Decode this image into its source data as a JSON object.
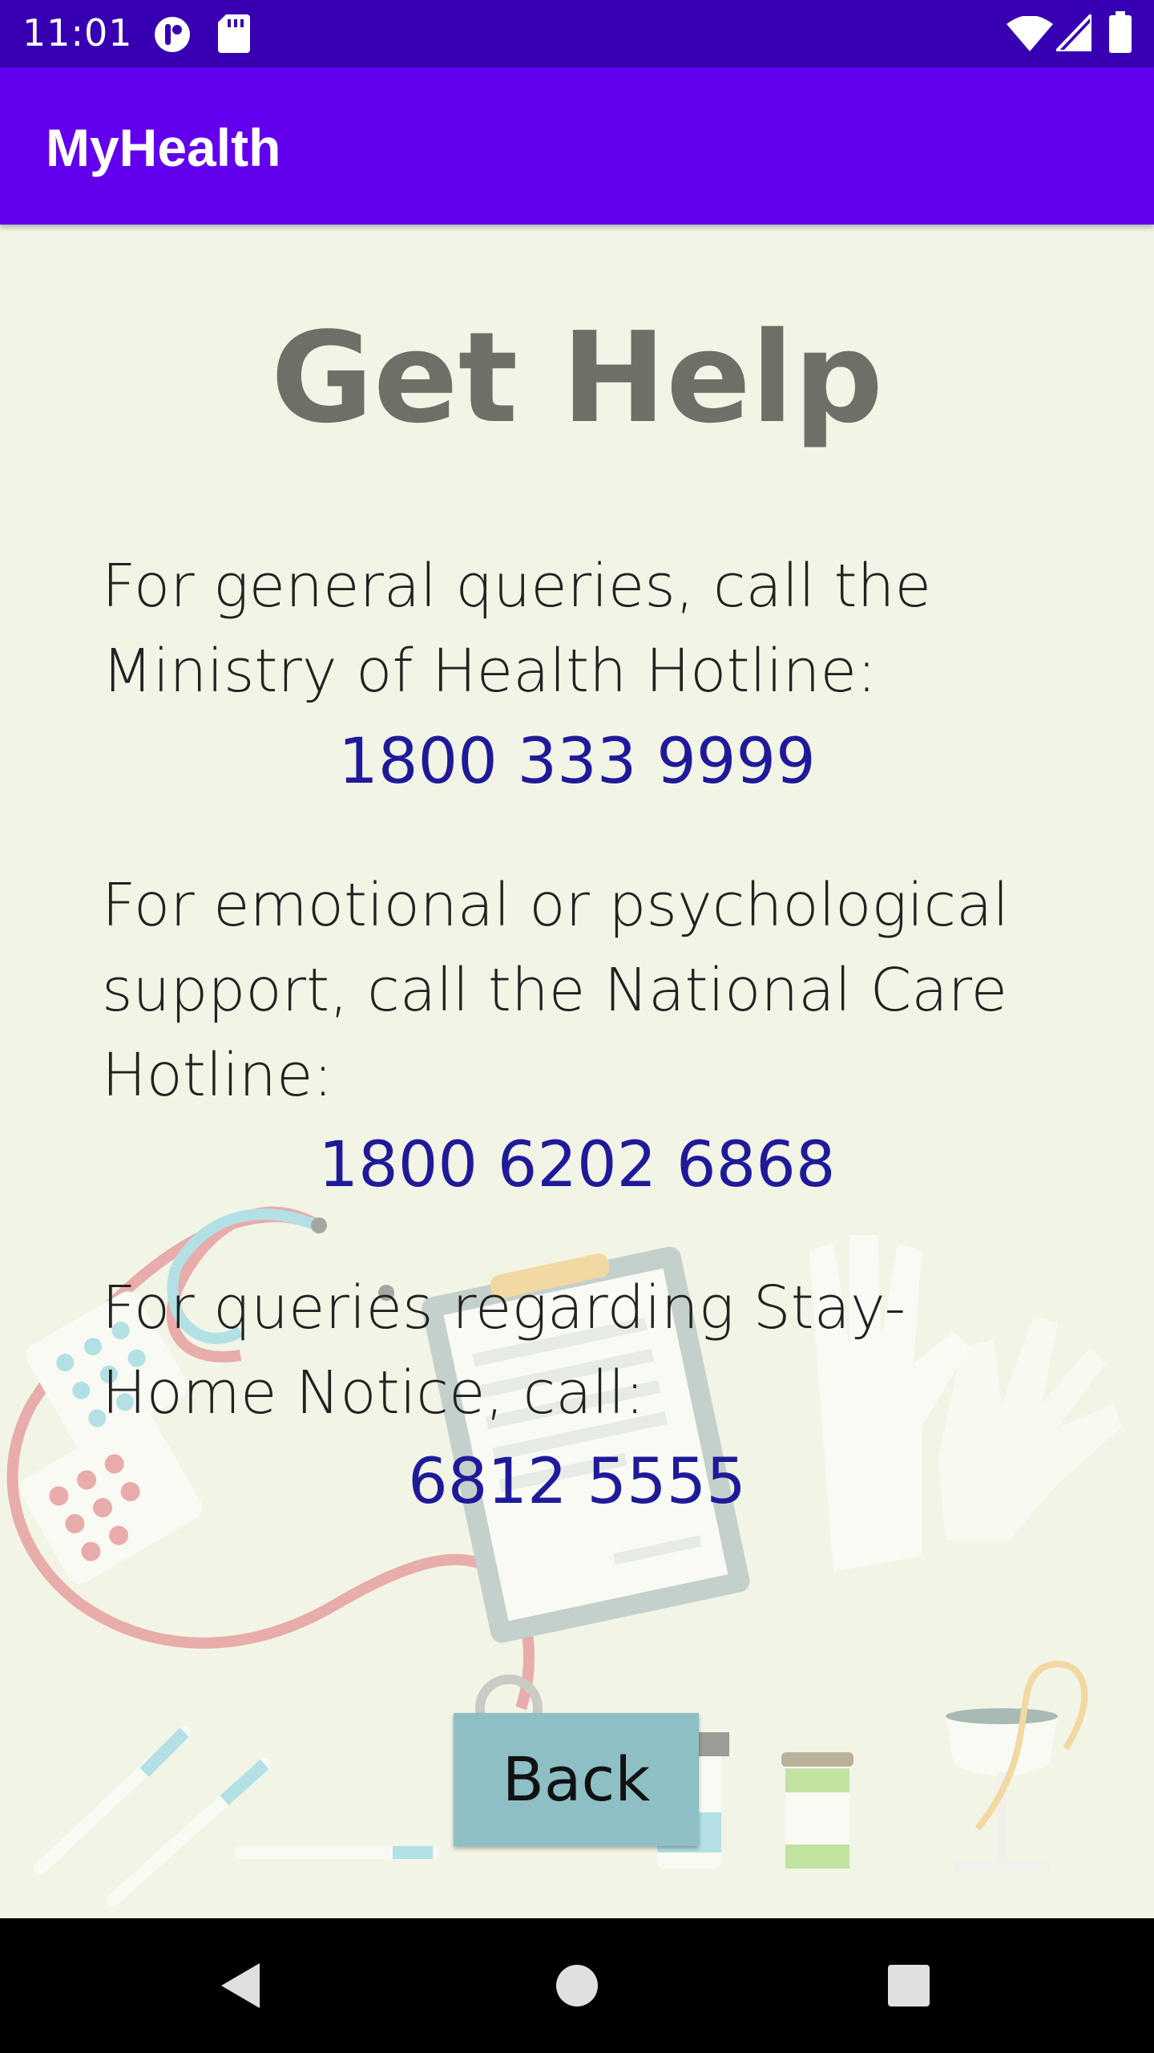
{
  "status_bar": {
    "time": "11:01",
    "icons": [
      "app-notification-icon",
      "sd-card-icon",
      "wifi-icon",
      "cell-signal-icon",
      "battery-icon"
    ]
  },
  "app_bar": {
    "title": "MyHealth"
  },
  "main": {
    "heading": "Get Help",
    "sections": [
      {
        "text": "For general queries, call the Ministry of Health Hotline:",
        "phone": "1800 333 9999"
      },
      {
        "text": "For emotional or psychological support, call the National Care Hotline:",
        "phone": "1800 6202 6868"
      },
      {
        "text": "For queries regarding Stay-Home Notice, call:",
        "phone": "6812 5555"
      }
    ],
    "back_label": "Back"
  },
  "nav_bar": {
    "icons": [
      "back-nav-icon",
      "home-nav-icon",
      "recents-nav-icon"
    ]
  },
  "colors": {
    "status_bar": "#3700b3",
    "app_bar": "#6200ee",
    "background": "#f2f4e6",
    "phone_text": "#1f1a99",
    "button": "#8dbfc5"
  }
}
